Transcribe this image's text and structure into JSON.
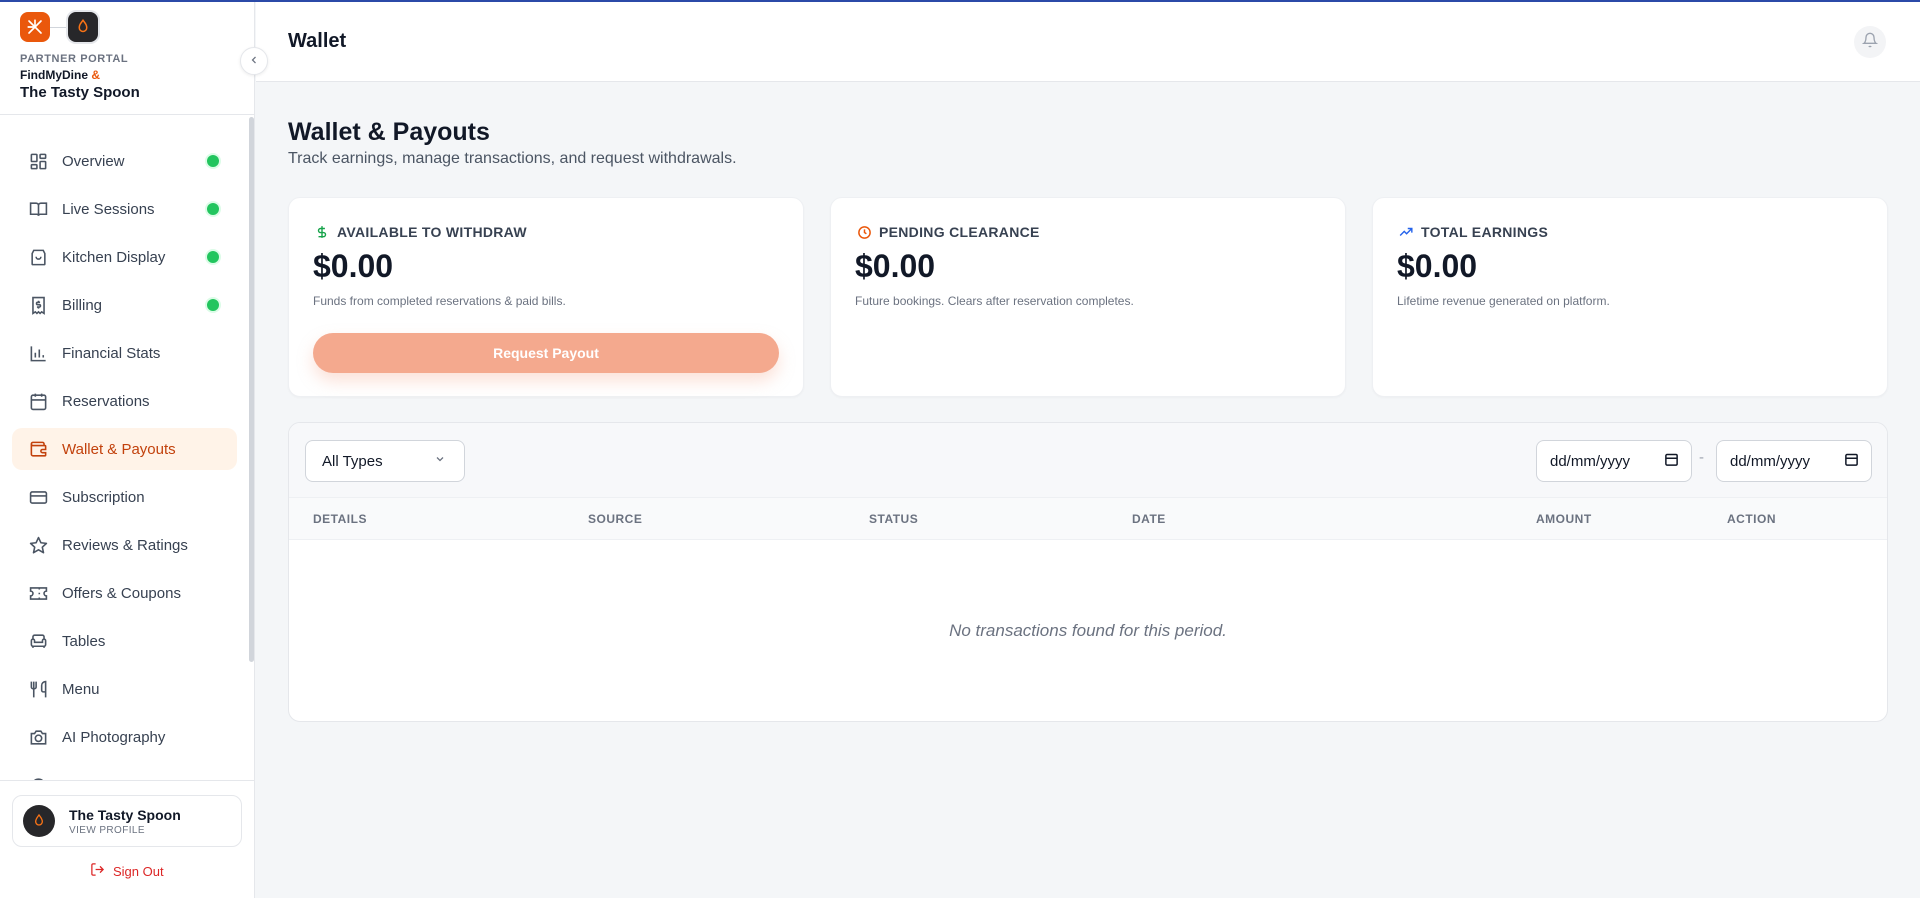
{
  "sidebar": {
    "portal_label": "PARTNER PORTAL",
    "brand_name": "FindMyDine",
    "brand_amp": "&",
    "restaurant_name": "The Tasty Spoon",
    "collapse_icon": "chevron-left-icon",
    "items": [
      {
        "label": "Overview",
        "icon": "dashboard-icon",
        "dot": true
      },
      {
        "label": "Live Sessions",
        "icon": "book-open-icon",
        "dot": true
      },
      {
        "label": "Kitchen Display",
        "icon": "shopping-bag-icon",
        "dot": true
      },
      {
        "label": "Billing",
        "icon": "receipt-icon",
        "dot": true
      },
      {
        "label": "Financial Stats",
        "icon": "bar-chart-icon",
        "dot": false
      },
      {
        "label": "Reservations",
        "icon": "calendar-icon",
        "dot": false
      },
      {
        "label": "Wallet & Payouts",
        "icon": "wallet-icon",
        "dot": false,
        "active": true
      },
      {
        "label": "Subscription",
        "icon": "credit-card-icon",
        "dot": false
      },
      {
        "label": "Reviews & Ratings",
        "icon": "star-icon",
        "dot": false
      },
      {
        "label": "Offers & Coupons",
        "icon": "ticket-icon",
        "dot": false
      },
      {
        "label": "Tables",
        "icon": "armchair-icon",
        "dot": false
      },
      {
        "label": "Menu",
        "icon": "utensils-icon",
        "dot": false
      },
      {
        "label": "AI Photography",
        "icon": "camera-icon",
        "dot": false
      }
    ],
    "profile": {
      "name": "The Tasty Spoon",
      "sub": "VIEW PROFILE"
    },
    "sign_out": "Sign Out"
  },
  "header": {
    "title": "Wallet",
    "bell_icon": "bell-icon"
  },
  "main": {
    "title": "Wallet & Payouts",
    "subtitle": "Track earnings, manage transactions, and request withdrawals.",
    "cards": [
      {
        "heading": "AVAILABLE TO WITHDRAW",
        "value": "$0.00",
        "note": "Funds from completed reservations & paid bills.",
        "icon": "dollar-icon",
        "icon_color": "#16a34a"
      },
      {
        "heading": "PENDING CLEARANCE",
        "value": "$0.00",
        "note": "Future bookings. Clears after reservation completes.",
        "icon": "clock-icon",
        "icon_color": "#ea580c"
      },
      {
        "heading": "TOTAL EARNINGS",
        "value": "$0.00",
        "note": "Lifetime revenue generated on platform.",
        "icon": "trending-up-icon",
        "icon_color": "#2563eb"
      }
    ],
    "payout_button": "Request Payout",
    "filters": {
      "type_value": "All Types",
      "date_from": "dd/mm/yyyy",
      "date_to": "dd/mm/yyyy",
      "separator": "-"
    },
    "table": {
      "columns": [
        "DETAILS",
        "SOURCE",
        "STATUS",
        "DATE",
        "AMOUNT",
        "ACTION"
      ],
      "empty_message": "No transactions found for this period."
    }
  },
  "colors": {
    "accent": "#ea580c",
    "active_bg": "#fff3e8",
    "status_dot": "#22c55e",
    "payout_button": "#f4a98e"
  }
}
